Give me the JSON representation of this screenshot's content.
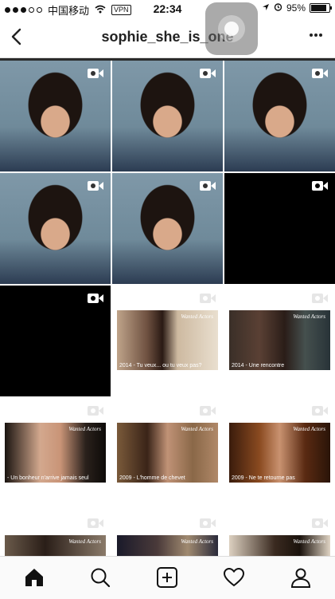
{
  "status_bar": {
    "carrier": "中国移动",
    "vpn": "VPN",
    "time": "22:34",
    "battery": "95%",
    "battery_level": 0.95
  },
  "nav": {
    "title": "sophie_she_is_one",
    "back_icon": "chevron-left-icon",
    "more_icon": "more-horizontal-icon"
  },
  "grid": {
    "tiles": [
      {
        "kind": "video",
        "icon": "video-camera-icon"
      },
      {
        "kind": "video",
        "icon": "video-camera-icon"
      },
      {
        "kind": "video",
        "icon": "video-camera-icon"
      },
      {
        "kind": "video",
        "icon": "video-camera-icon"
      },
      {
        "kind": "video",
        "icon": "video-camera-icon"
      },
      {
        "kind": "video",
        "icon": "video-camera-icon"
      },
      {
        "kind": "video",
        "icon": "video-camera-icon"
      },
      {
        "kind": "movie",
        "icon": "video-camera-icon",
        "brand": "Wanted Actors",
        "caption": "2014 - Tu veux... ou tu veux pas?"
      },
      {
        "kind": "movie",
        "icon": "video-camera-icon",
        "brand": "Wanted Actors",
        "caption": "2014 - Une rencontre"
      },
      {
        "kind": "movie",
        "icon": "video-camera-icon",
        "brand": "Wanted Actors",
        "caption": "- Un bonheur n'arrive jamais seul"
      },
      {
        "kind": "movie",
        "icon": "video-camera-icon",
        "brand": "Wanted Actors",
        "caption": "2009 - L'homme de chevet"
      },
      {
        "kind": "movie",
        "icon": "video-camera-icon",
        "brand": "Wanted Actors",
        "caption": "2009 - Ne te retourne pas"
      },
      {
        "kind": "movie",
        "icon": "video-camera-icon",
        "brand": "Wanted Actors",
        "caption": ""
      },
      {
        "kind": "movie",
        "icon": "video-camera-icon",
        "brand": "Wanted Actors",
        "caption": ""
      },
      {
        "kind": "movie",
        "icon": "video-camera-icon",
        "brand": "Wanted Actors",
        "caption": ""
      }
    ]
  },
  "tab_bar": {
    "items": [
      "home-icon",
      "search-icon",
      "add-post-icon",
      "heart-icon",
      "profile-icon"
    ]
  },
  "colors": {
    "background": "#ffffff",
    "text": "#111111",
    "divider": "#dddddd"
  }
}
